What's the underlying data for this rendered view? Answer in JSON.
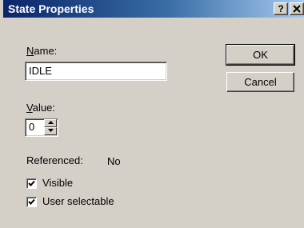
{
  "window": {
    "title": "State Properties",
    "help_label": "?",
    "close_label": "x"
  },
  "fields": {
    "name_label": "Name:",
    "name_value": "IDLE",
    "value_label": "Value:",
    "value_value": "0"
  },
  "buttons": {
    "ok_label": "OK",
    "cancel_label": "Cancel"
  },
  "referenced": {
    "label": "Referenced:",
    "value": "No"
  },
  "checkboxes": [
    {
      "label": "Visible",
      "checked": true
    },
    {
      "label": "User selectable",
      "checked": true
    }
  ],
  "colors": {
    "title_start": "#0a246a",
    "title_end": "#a6caf0",
    "face": "#d4d0c8"
  }
}
